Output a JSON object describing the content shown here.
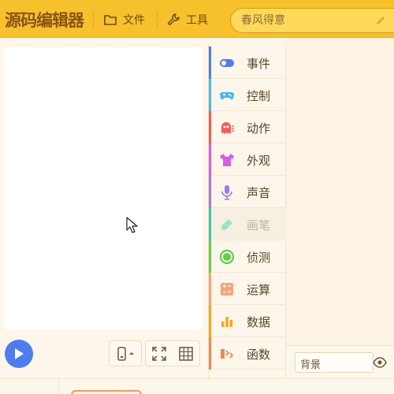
{
  "app": {
    "logo_text": "源码编辑器"
  },
  "menu": {
    "file_label": "文件",
    "tools_label": "工具"
  },
  "project": {
    "name_placeholder": "春风得意"
  },
  "stage_controls": {
    "play_icon": "play-icon",
    "device_icon": "phone-rotate-icon",
    "fullscreen_icon": "expand-icon",
    "grid_icon": "grid-icon"
  },
  "categories": [
    {
      "label": "事件",
      "icon": "toggle-icon",
      "color": "#4e7df0"
    },
    {
      "label": "控制",
      "icon": "gamepad-icon",
      "color": "#4cb7f0"
    },
    {
      "label": "动作",
      "icon": "ghost-icon",
      "color": "#ef5a5a"
    },
    {
      "label": "外观",
      "icon": "shirt-icon",
      "color": "#d55ee8"
    },
    {
      "label": "声音",
      "icon": "microphone-icon",
      "color": "#a177f0"
    },
    {
      "label": "画笔",
      "icon": "pen-icon",
      "color": "#37c9a5",
      "disabled": true
    },
    {
      "label": "侦测",
      "icon": "target-icon",
      "color": "#5fcf4b"
    },
    {
      "label": "运算",
      "icon": "calculator-icon",
      "color": "#f3a57a"
    },
    {
      "label": "数据",
      "icon": "bar-chart-icon",
      "color": "#f5a623"
    },
    {
      "label": "函数",
      "icon": "function-icon",
      "color": "#f08a4b"
    }
  ],
  "sprite_panel": {
    "background_label": "背景"
  },
  "colors": {
    "topbar": "#f7c12b",
    "logo": "#8a5418",
    "play": "#4e7df0"
  }
}
